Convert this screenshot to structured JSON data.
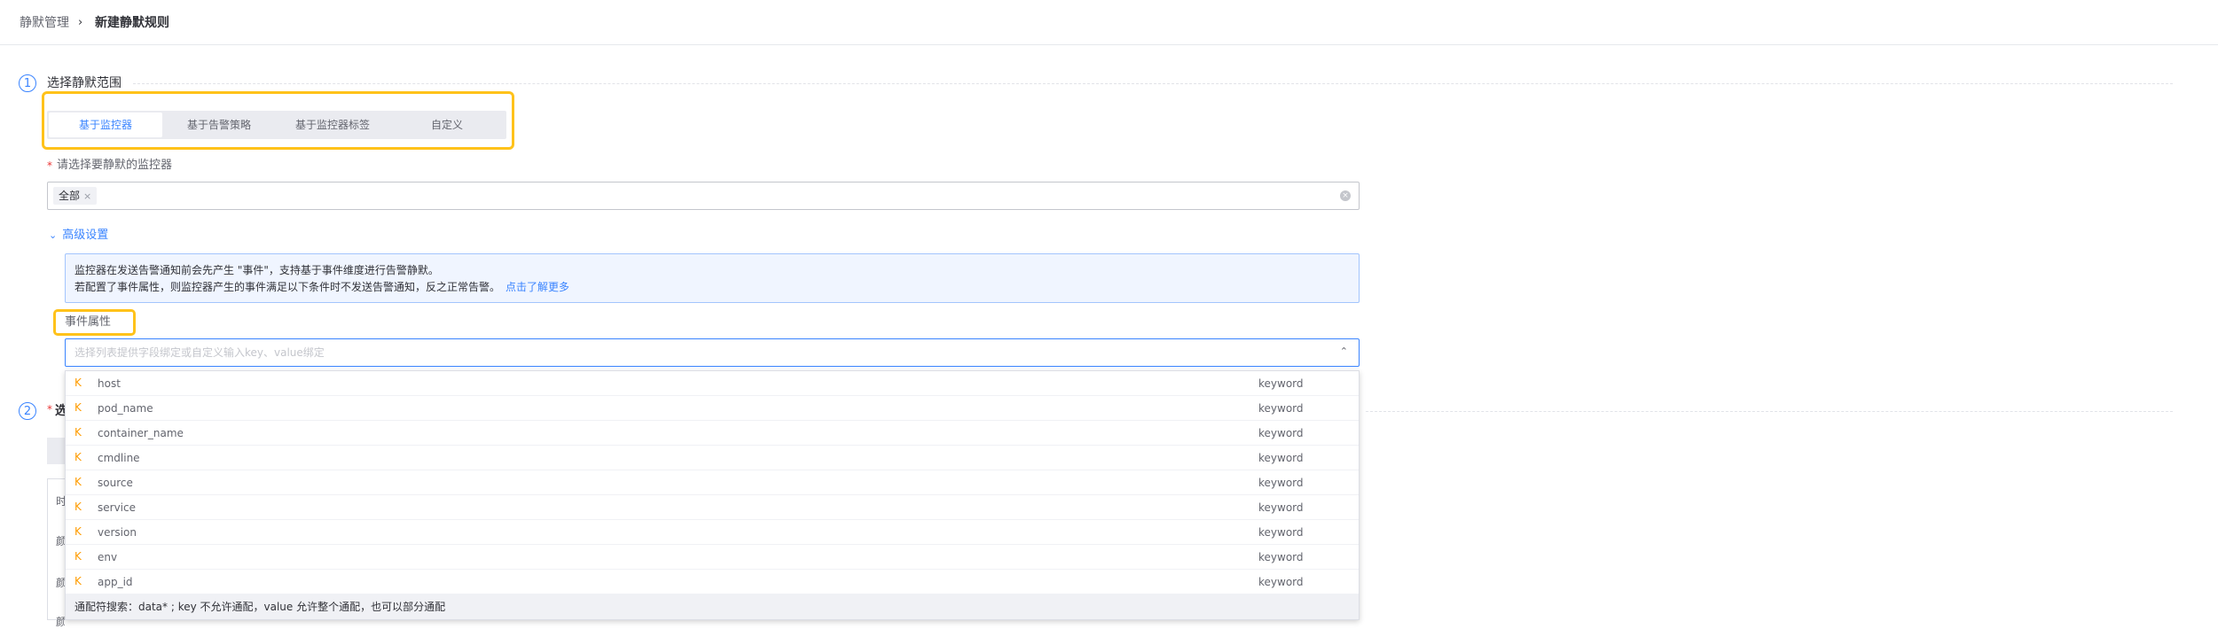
{
  "breadcrumb": {
    "parent": "静默管理",
    "separator": "›",
    "current": "新建静默规则"
  },
  "step1": {
    "number": "1",
    "title": "选择静默范围",
    "tabs": [
      {
        "label": "基于监控器",
        "active": true
      },
      {
        "label": "基于告警策略",
        "active": false
      },
      {
        "label": "基于监控器标签",
        "active": false
      },
      {
        "label": "自定义",
        "active": false
      }
    ],
    "monitor_field": {
      "required_mark": "*",
      "label": "请选择要静默的监控器",
      "selected_tag": "全部",
      "tag_remove": "×",
      "clear": "×"
    },
    "advanced": {
      "chevron": "⌄",
      "label": "高级设置"
    },
    "info": {
      "line1": "监控器在发送告警通知前会先产生 \"事件\"，支持基于事件维度进行告警静默。",
      "line2": "若配置了事件属性，则监控器产生的事件满足以下条件时不发送告警通知，反之正常告警。",
      "link": "点击了解更多"
    },
    "event_attr": {
      "label": "事件属性",
      "placeholder": "选择列表提供字段绑定或自定义输入key、value绑定",
      "arrow": "⌃",
      "options": [
        {
          "badge": "K",
          "name": "host",
          "type": "keyword"
        },
        {
          "badge": "K",
          "name": "pod_name",
          "type": "keyword"
        },
        {
          "badge": "K",
          "name": "container_name",
          "type": "keyword"
        },
        {
          "badge": "K",
          "name": "cmdline",
          "type": "keyword"
        },
        {
          "badge": "K",
          "name": "source",
          "type": "keyword"
        },
        {
          "badge": "K",
          "name": "service",
          "type": "keyword"
        },
        {
          "badge": "K",
          "name": "version",
          "type": "keyword"
        },
        {
          "badge": "K",
          "name": "env",
          "type": "keyword"
        },
        {
          "badge": "K",
          "name": "app_id",
          "type": "keyword"
        }
      ],
      "footer_tip": "通配符搜索：data* ; key 不允许通配，value 允许整个通配，也可以部分通配"
    }
  },
  "step2": {
    "number": "2",
    "required_mark": "*",
    "title_partial": "选",
    "partial_labels": [
      "时",
      "颜",
      "颜",
      "颜"
    ]
  },
  "colors": {
    "primary": "#3a84ff",
    "highlight": "#ffc21a",
    "keyword_badge": "#ff9c01",
    "required": "#ea3636"
  }
}
